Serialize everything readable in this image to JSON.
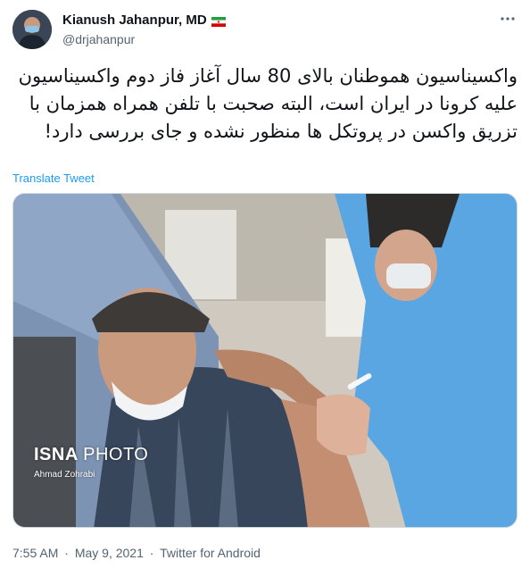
{
  "author": {
    "display_name": "Kianush Jahanpur, MD",
    "handle": "@drjahanpur",
    "flag_icon": "iran-flag-icon"
  },
  "tweet": {
    "text": "واکسیناسیون هموطنان بالای 80 سال آغاز فاز دوم واکسیناسیون علیه کرونا در ایران است، البته صحبت با تلفن همراه همزمان با تزریق واکسن در پروتکل ها منظور نشده و جای بررسی دارد!",
    "translate_label": "Translate Tweet"
  },
  "media": {
    "watermark_brand_bold": "ISNA",
    "watermark_brand_thin": "PHOTO",
    "photo_credit": "Ahmad Zohrabi"
  },
  "meta": {
    "time": "7:55 AM",
    "date": "May 9, 2021",
    "source": "Twitter for Android",
    "separator": "·"
  },
  "colors": {
    "link": "#1d9bf0",
    "secondary_text": "#536471"
  }
}
